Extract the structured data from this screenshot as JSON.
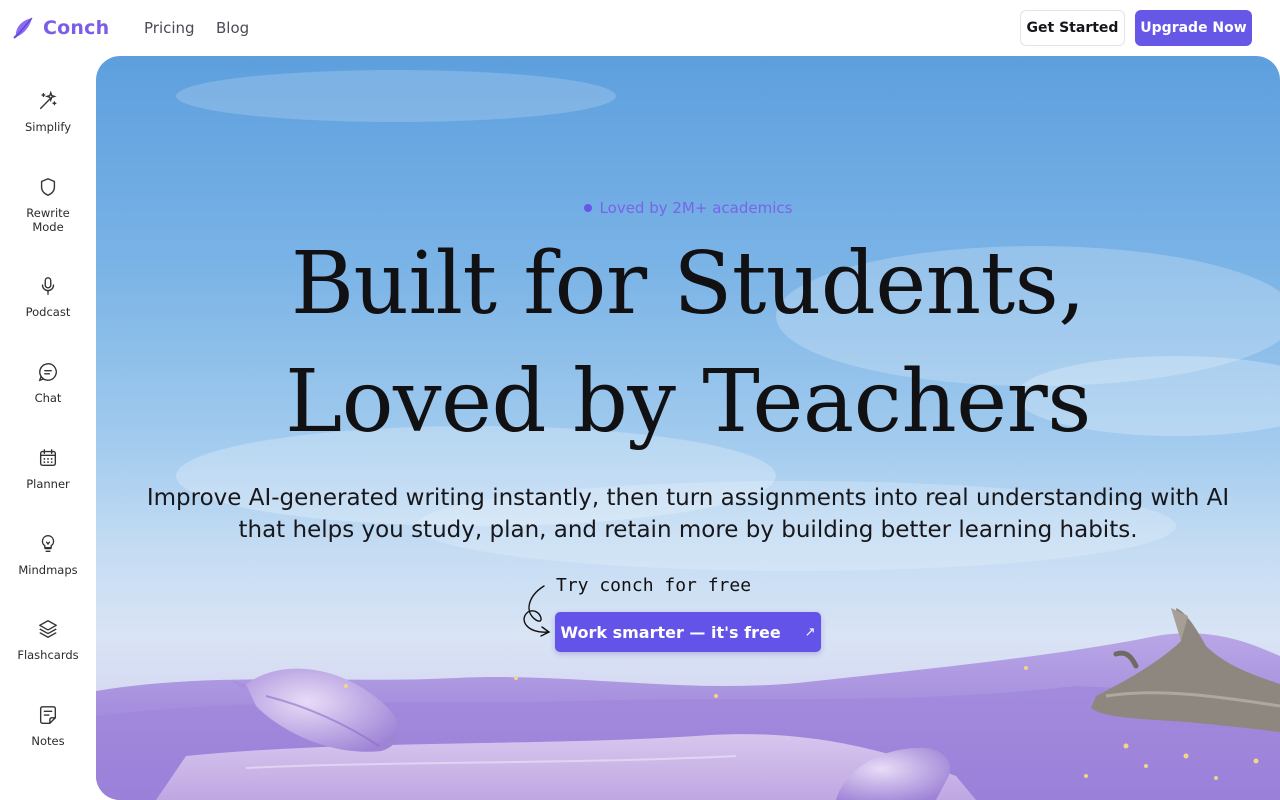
{
  "brand": {
    "name": "Conch",
    "accent": "#6757e6"
  },
  "nav": {
    "links": [
      "Pricing",
      "Blog"
    ],
    "get_started": "Get Started",
    "upgrade": "Upgrade Now"
  },
  "sidebar": {
    "items": [
      {
        "label": "Simplify",
        "icon": "sparkles-icon"
      },
      {
        "label": "Rewrite\nMode",
        "icon": "shield-icon"
      },
      {
        "label": "Podcast",
        "icon": "microphone-icon"
      },
      {
        "label": "Chat",
        "icon": "chat-bubble-icon"
      },
      {
        "label": "Planner",
        "icon": "calendar-icon"
      },
      {
        "label": "Mindmaps",
        "icon": "lightbulb-icon"
      },
      {
        "label": "Flashcards",
        "icon": "layers-icon"
      },
      {
        "label": "Notes",
        "icon": "note-icon"
      }
    ]
  },
  "hero": {
    "badge": "Loved by 2M+ academics",
    "headline_line1": "Built for Students,",
    "headline_line2": "Loved by Teachers",
    "subtitle": "Improve AI-generated writing instantly, then turn assignments into real understanding with AI that helps you study, plan, and retain more by building better learning habits.",
    "try_note": "Try conch for free",
    "cta": "Work smarter — it's free"
  }
}
